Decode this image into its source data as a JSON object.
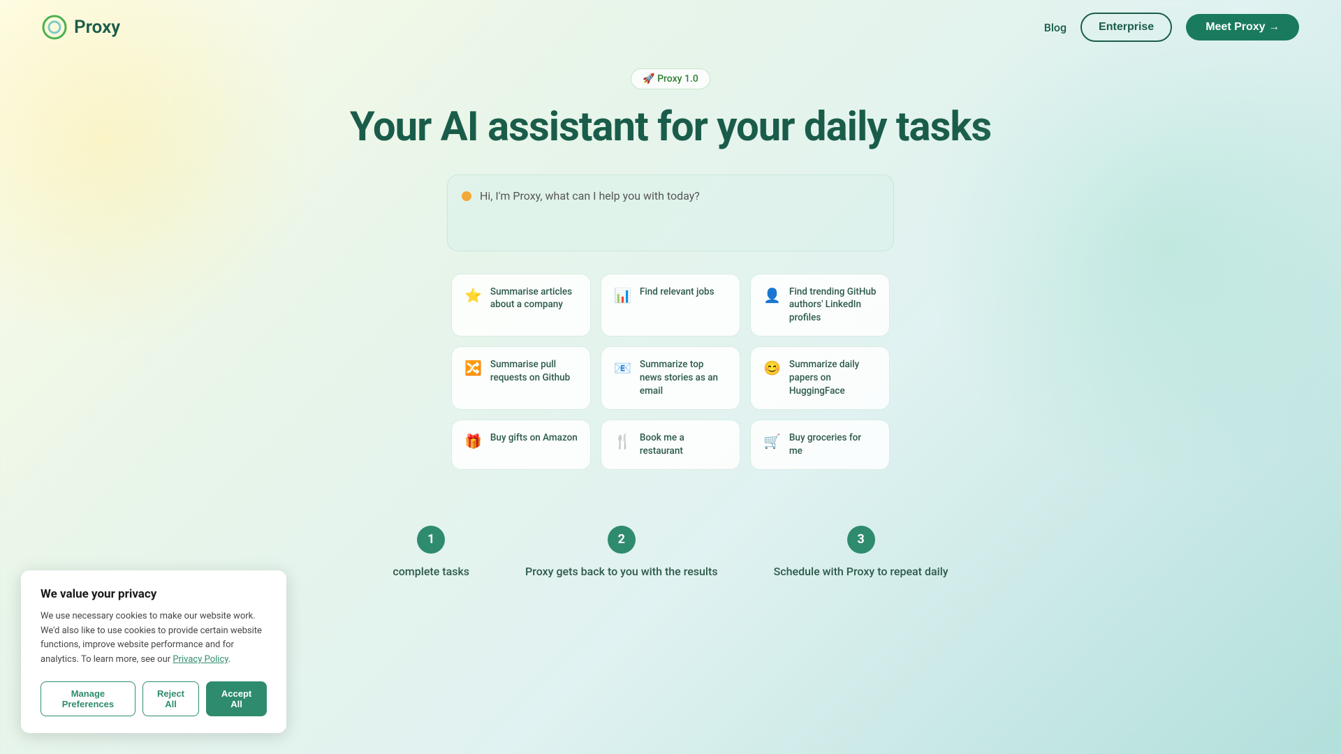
{
  "navbar": {
    "logo_text": "Proxy",
    "blog_label": "Blog",
    "enterprise_label": "Enterprise",
    "meet_proxy_label": "Meet Proxy →"
  },
  "hero": {
    "badge_text": "🚀 Proxy 1.0",
    "title": "Your AI assistant for your daily tasks",
    "chat_placeholder": "Hi, I'm Proxy, what can I help you with today?"
  },
  "suggestions": [
    {
      "icon": "⭐",
      "text": "Summarise articles about a company"
    },
    {
      "icon": "📊",
      "text": "Find relevant jobs"
    },
    {
      "icon": "👤",
      "text": "Find trending GitHub authors' LinkedIn profiles"
    },
    {
      "icon": "🔀",
      "text": "Summarise pull requests on Github"
    },
    {
      "icon": "📧",
      "text": "Summarize top news stories as an email"
    },
    {
      "icon": "😊",
      "text": "Summarize daily papers on HuggingFace"
    },
    {
      "icon": "🎁",
      "text": "Buy gifts on Amazon"
    },
    {
      "icon": "🍴",
      "text": "Book me a restaurant"
    },
    {
      "icon": "🛒",
      "text": "Buy groceries for me"
    }
  ],
  "steps": [
    {
      "number": "1",
      "text": "complete tasks"
    },
    {
      "number": "2",
      "text": "Proxy gets back to you with the results"
    },
    {
      "number": "3",
      "text": "Schedule with Proxy to repeat daily"
    }
  ],
  "cookie": {
    "title": "We value your privacy",
    "body": "We use necessary cookies to make our website work. We'd also like to use cookies to provide certain website functions, improve website performance and for analytics. To learn more, see our ",
    "link_text": "Privacy Policy",
    "manage_label": "Manage Preferences",
    "reject_label": "Reject All",
    "accept_label": "Accept All"
  }
}
